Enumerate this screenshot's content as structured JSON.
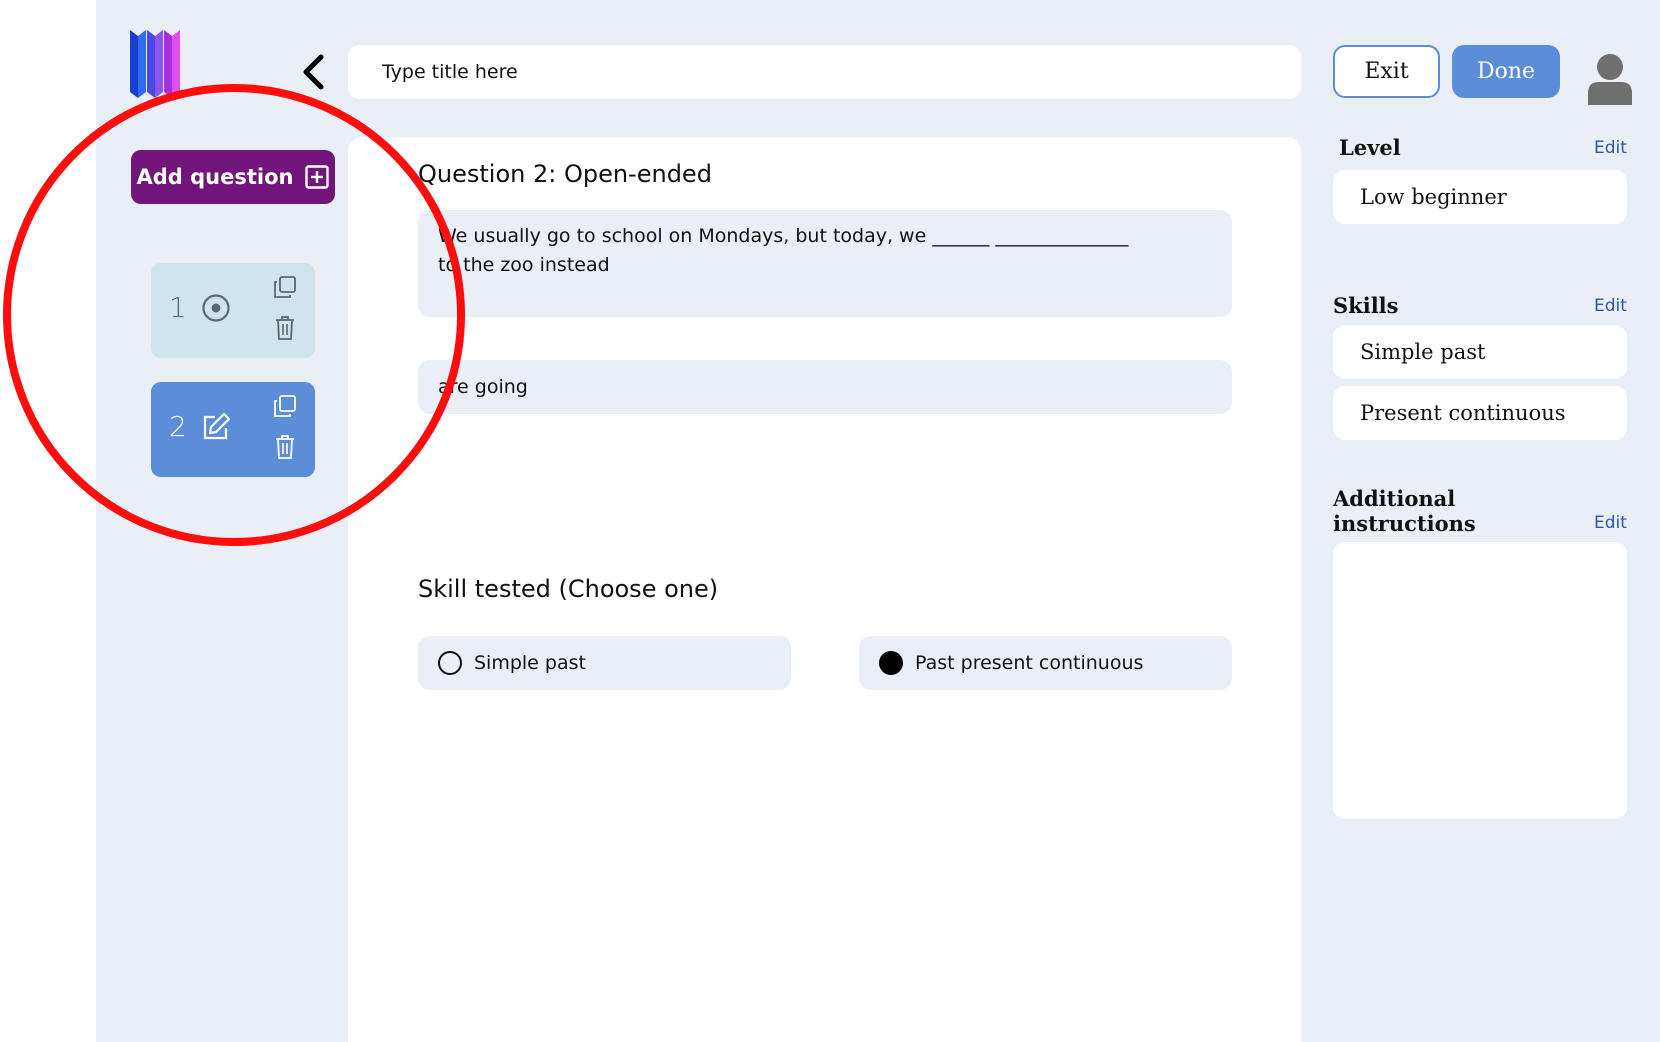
{
  "header": {
    "title_placeholder": "Type title here",
    "exit_label": "Exit",
    "done_label": "Done"
  },
  "sidebar": {
    "add_question_label": "Add question",
    "questions": [
      {
        "number": "1",
        "type_icon": "target-icon",
        "state": "default"
      },
      {
        "number": "2",
        "type_icon": "edit-icon",
        "state": "selected"
      }
    ]
  },
  "editor": {
    "question_heading": "Question 2: Open-ended",
    "question_text": "We usually go to school on Mondays, but today, we ______ ______________ to the zoo instead",
    "answer": "are going",
    "skill_heading": "Skill tested (Choose one)",
    "skill_options": [
      {
        "label": "Simple past",
        "selected": false
      },
      {
        "label": "Past present continuous",
        "selected": true
      }
    ]
  },
  "right_panel": {
    "level_label": "Level",
    "level_value": "Low beginner",
    "skills_label": "Skills",
    "skills": [
      "Simple past",
      "Present continuous"
    ],
    "instructions_label_line1": "Additional",
    "instructions_label_line2": "instructions",
    "instructions_value": "",
    "edit_label": "Edit"
  },
  "colors": {
    "background": "#e9eef7",
    "accent_blue": "#5b8ed9",
    "add_button_purple": "#72157a",
    "selected_card_light": "#cfe4ee",
    "highlight_circle": "#ff0d0d",
    "edit_link": "#2b55b3"
  }
}
